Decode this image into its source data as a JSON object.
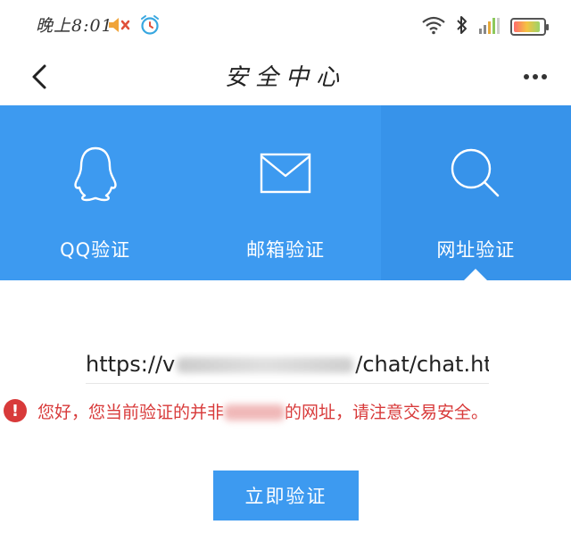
{
  "status_bar": {
    "time": "晚上8:01",
    "left_icons": [
      "mute-icon",
      "alarm-icon"
    ],
    "right_icons": [
      "wifi-icon",
      "bluetooth-icon",
      "signal-icon",
      "battery-icon"
    ],
    "battery_level": 0.9
  },
  "nav": {
    "title": "安全中心",
    "back_icon": "chevron-left-icon",
    "more_icon": "more-dots-icon"
  },
  "tabs": [
    {
      "label": "QQ验证",
      "icon": "qq-penguin-icon",
      "active": false
    },
    {
      "label": "邮箱验证",
      "icon": "mail-icon",
      "active": false
    },
    {
      "label": "网址验证",
      "icon": "search-icon",
      "active": true
    }
  ],
  "url": {
    "prefix": "https://v",
    "suffix": "/chat/chat.htm"
  },
  "warning": {
    "icon": "alert-icon",
    "text_before": "您好，您当前验证的并非",
    "text_after": "的网址，请注意交易安全。"
  },
  "verify_button": {
    "label": "立即验证"
  },
  "colors": {
    "accent": "#3d9af0",
    "active_tab": "#3793ea",
    "warning": "#d83a3a"
  }
}
